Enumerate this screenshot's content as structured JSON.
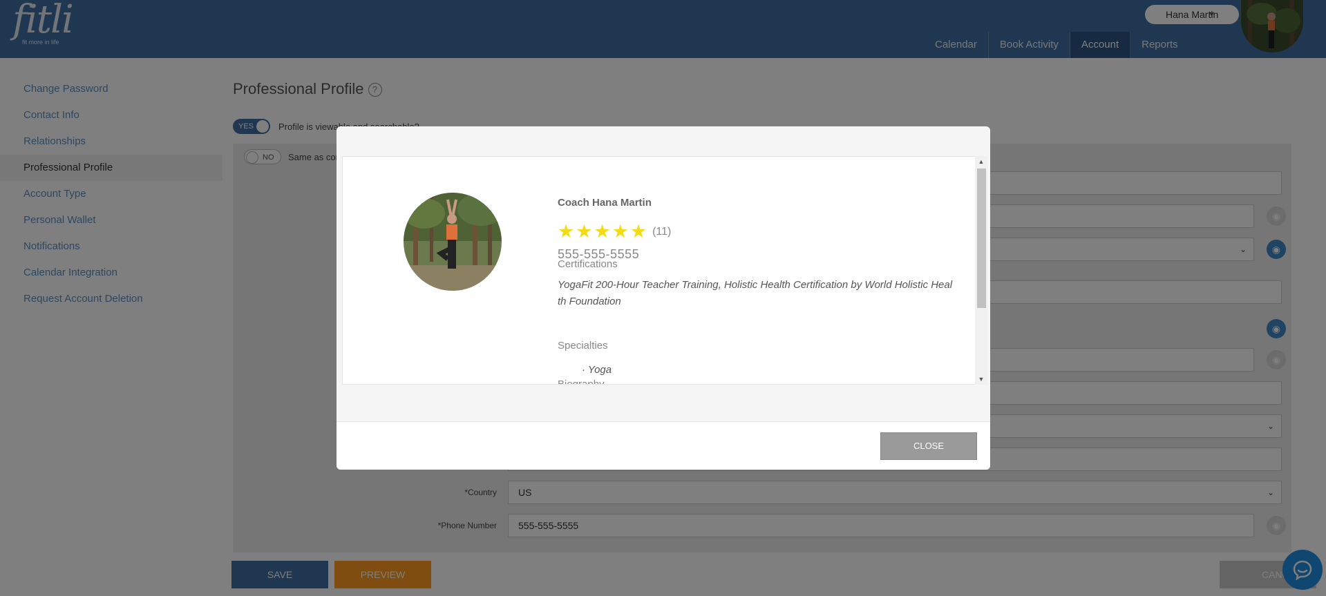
{
  "header": {
    "logo_text": "fitli",
    "logo_tagline": "fit more in life",
    "user_name": "Hana Martin",
    "nav": [
      "Calendar",
      "Book Activity",
      "Account",
      "Reports"
    ]
  },
  "sidebar": {
    "items": [
      "Change Password",
      "Contact Info",
      "Relationships",
      "Professional Profile",
      "Account Type",
      "Personal Wallet",
      "Notifications",
      "Calendar Integration",
      "Request Account Deletion"
    ]
  },
  "main": {
    "title": "Professional Profile",
    "toggle_yes": "YES",
    "toggle_yes_label": "Profile is viewable and searchable?",
    "toggle_no": "NO",
    "toggle_no_label": "Same as con",
    "country_label": "*Country",
    "country_value": "US",
    "phone_label": "*Phone Number",
    "phone_value": "555-555-5555",
    "save_label": "SAVE",
    "preview_label": "PREVIEW",
    "cancel_label": "CANCE"
  },
  "modal": {
    "coach_name": "Coach Hana Martin",
    "stars": 5,
    "rating_count": "(11)",
    "phone": "555-555-5555",
    "certifications_heading": "Certifications",
    "certifications_text": "YogaFit 200-Hour Teacher Training, Holistic Health Certification by World Holistic Heal th Foundation",
    "specialties_heading": "Specialties",
    "specialty_item": "· Yoga",
    "biography_heading": "Biography",
    "close_label": "CLOSE"
  },
  "colors": {
    "header_bg": "#3f6ea1",
    "accent_blue": "#3f87c6",
    "preview_orange": "#ff9a1f",
    "star": "#f5dc12"
  }
}
